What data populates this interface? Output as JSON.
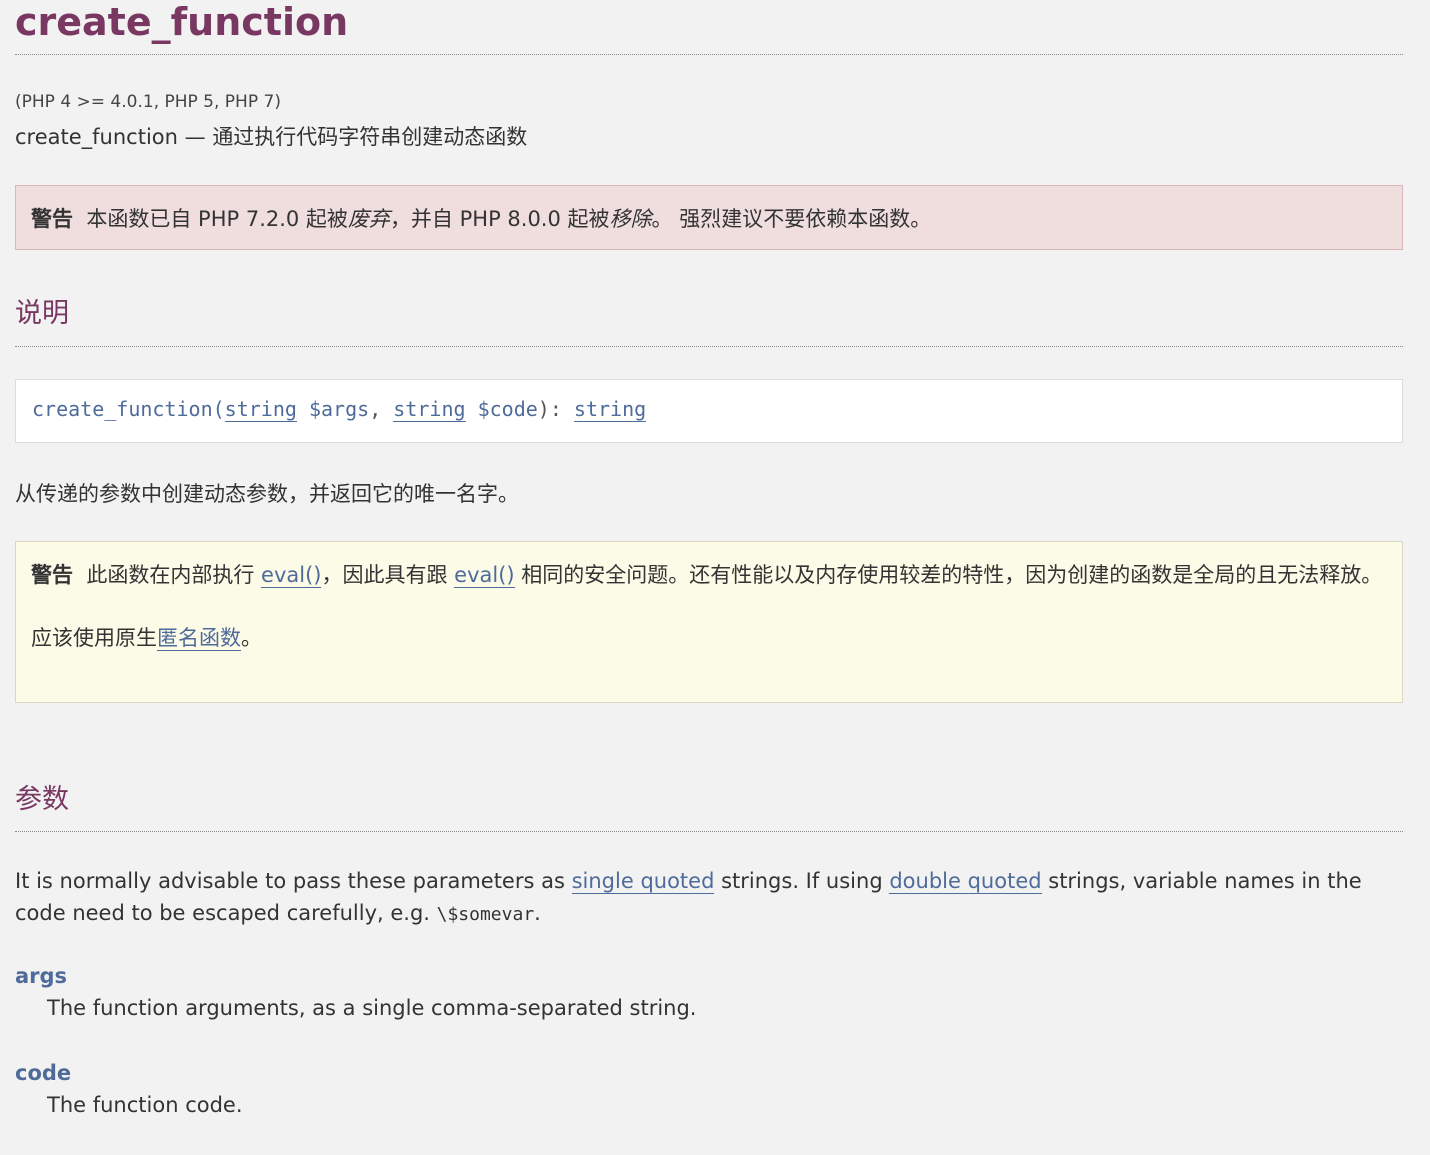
{
  "title": "create_function",
  "version": "(PHP 4 >= 4.0.1, PHP 5, PHP 7)",
  "refpurpose": {
    "name": "create_function",
    "dash": " — ",
    "desc": "通过执行代码字符串创建动态函数"
  },
  "deprecation_warning": {
    "label": "警告",
    "t1": "本函数已自 PHP 7.2.0 起被",
    "em1": "废弃",
    "t2": "，并自 PHP 8.0.0 起被",
    "em2": "移除",
    "t3": "。 强烈建议不要依赖本函数。"
  },
  "section_description": "说明",
  "signature": {
    "name": "create_function",
    "open": "(",
    "type1": "string",
    "param1": "$args",
    "comma": ", ",
    "type2": "string",
    "param2": "$code",
    "close": "): ",
    "return_type": "string"
  },
  "description_text": "从传递的参数中创建动态参数，并返回它的唯一名字。",
  "security_warning": {
    "label": "警告",
    "t1": "此函数在内部执行",
    "link1": "eval()",
    "t2": "，因此具有跟",
    "link2": "eval()",
    "t3": "相同的安全问题。还有性能以及内存使用较差的特性，因为创建的函数是全局的且无法释放。",
    "t4": "应该使用原生",
    "link3": "匿名函数",
    "t5": "。"
  },
  "section_parameters": "参数",
  "params_intro": {
    "t1": "It is normally advisable to pass these parameters as ",
    "link1": "single quoted",
    "t2": " strings. If using ",
    "link2": "double quoted",
    "t3": " strings, variable names in the code need to be escaped carefully, e.g. ",
    "code": "\\$somevar",
    "t4": "."
  },
  "params": [
    {
      "name": "args",
      "desc": "The function arguments, as a single comma-separated string."
    },
    {
      "name": "code",
      "desc": "The function code."
    }
  ]
}
